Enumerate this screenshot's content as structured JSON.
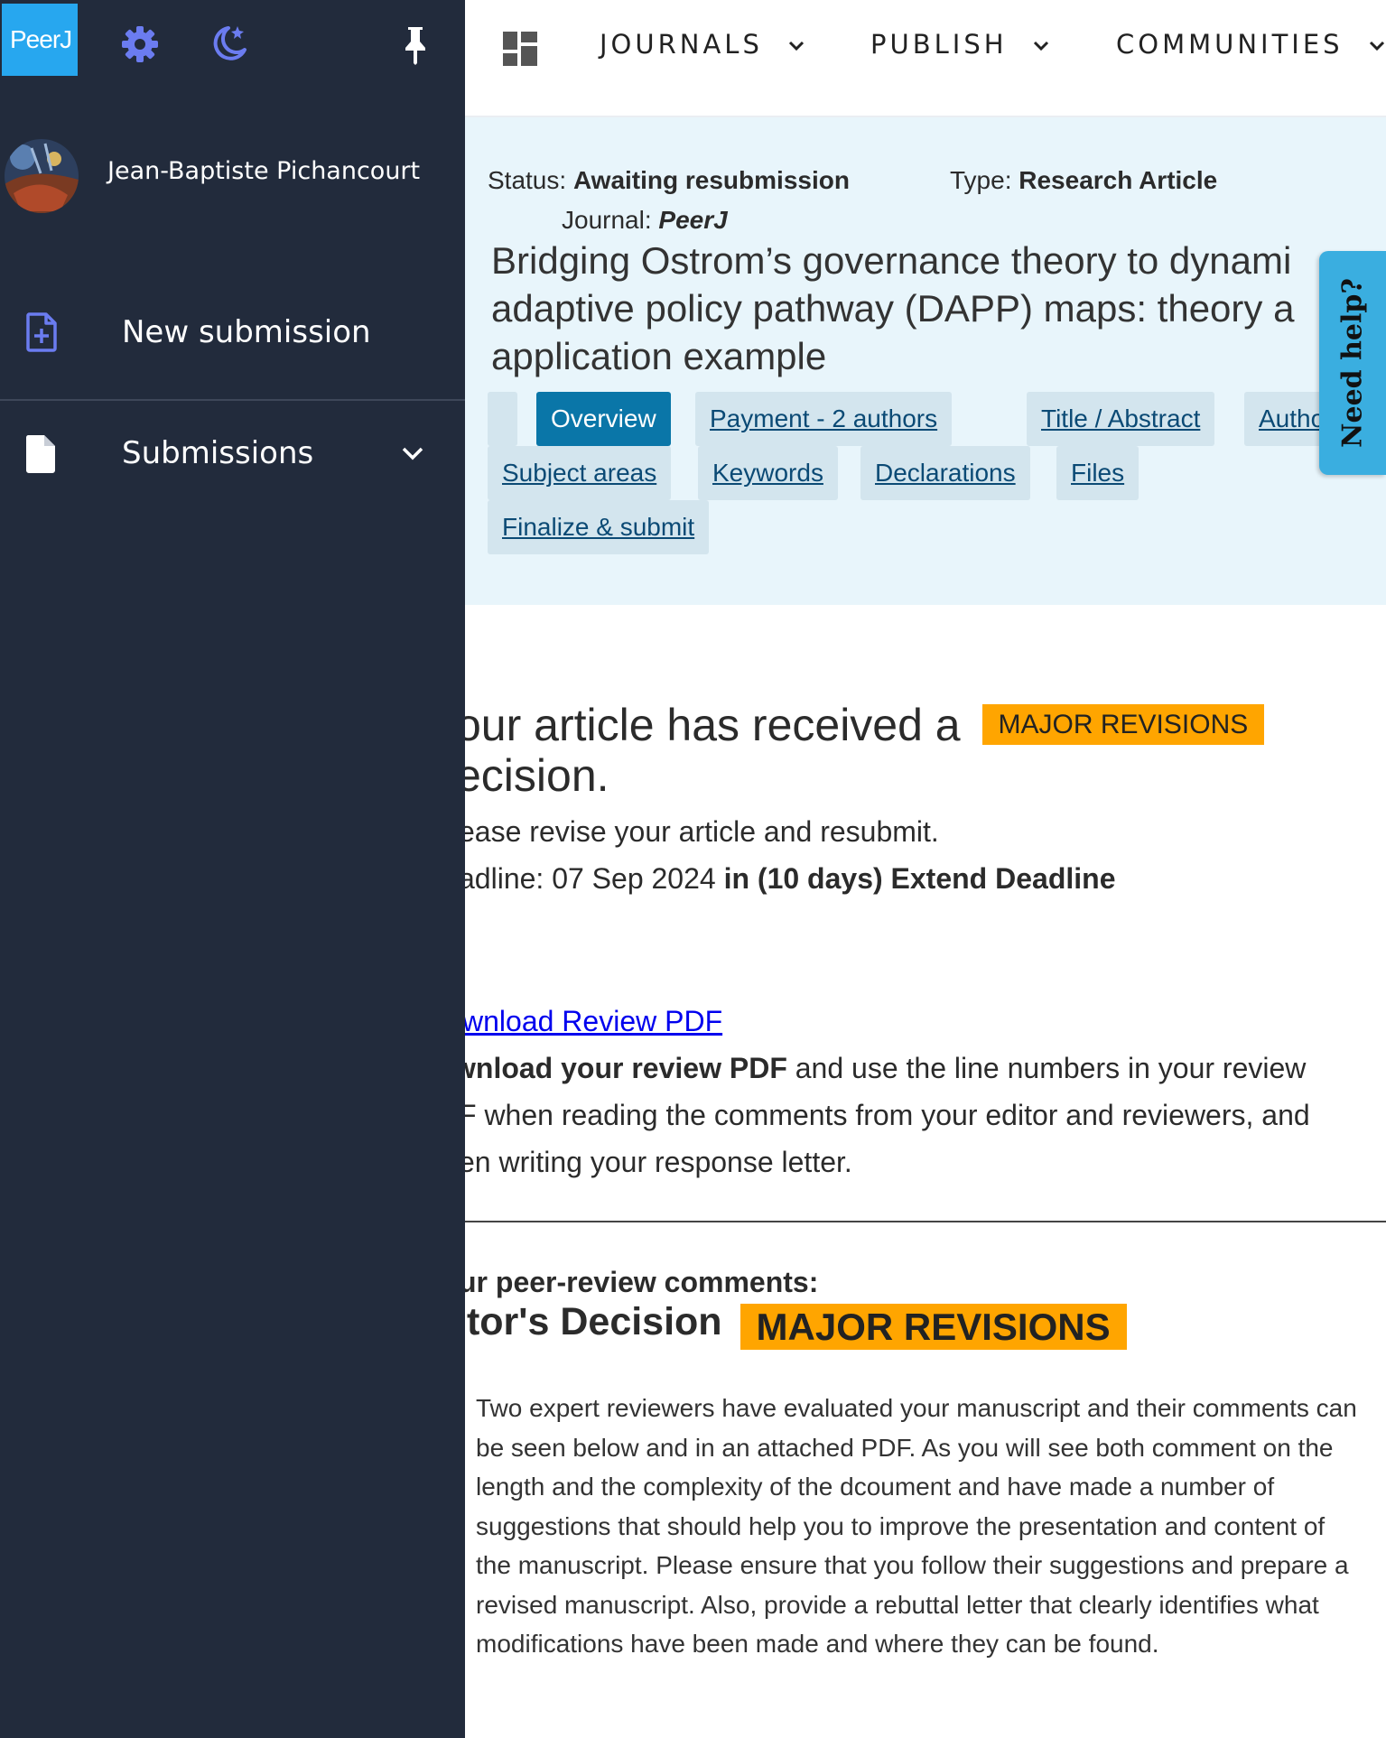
{
  "nav": {
    "items": [
      {
        "label": "JOURNALS"
      },
      {
        "label": "PUBLISH"
      },
      {
        "label": "COMMUNITIES"
      }
    ]
  },
  "sidebar": {
    "logo_text": "PeerJ",
    "user_name": "Jean-Baptiste Pichancourt",
    "new_submission_label": "New submission",
    "submissions_label": "Submissions"
  },
  "article": {
    "status_label": "Status:",
    "status_value": "Awaiting resubmission",
    "type_label": "Type:",
    "type_value": "Research Article",
    "journal_label": "Journal:",
    "journal_value": "PeerJ",
    "title": "Bridging Ostrom’s governance theory to dynami adaptive policy pathway (DAPP) maps: theory a application example"
  },
  "tabs": [
    {
      "label": "Overview"
    },
    {
      "label": "Payment - 2 authors"
    },
    {
      "label": "Title / Abstract"
    },
    {
      "label": "Autho"
    },
    {
      "label": "Subject areas"
    },
    {
      "label": "Keywords"
    },
    {
      "label": "Declarations"
    },
    {
      "label": "Files"
    },
    {
      "label": "Finalize & submit"
    }
  ],
  "help_label": "Need help?",
  "decision": {
    "heading_part1": "our article has received a",
    "badge": "MAJOR REVISIONS",
    "heading_part2": "ecision.",
    "revise_text": "ease revise your article and resubmit.",
    "deadline_prefix": "adline: 07 Sep 2024",
    "deadline_bold": "in (10 days) Extend Deadline",
    "download_link": "wnload Review PDF",
    "download_bold": "wnload your review PDF",
    "download_line1_rest": "and use the line numbers in your review",
    "download_line2": "F when reading the comments from your editor and reviewers, and",
    "download_line3": "en writing your response letter.",
    "comments_heading": "ur peer-review comments:",
    "editor_heading": "itor's Decision",
    "editor_badge": "MAJOR REVISIONS",
    "editor_text": "Two expert reviewers have evaluated your manuscript and their comments can be seen below and in an attached PDF. As you will see both comment on the length and the complexity of the dcoument and have made a number of suggestions that should help you to improve the presentation and content of the manuscript. Please ensure that you follow their suggestions and prepare a revised manuscript. Also, provide a rebuttal letter that clearly identifies what modifications have been made and where they can be found."
  },
  "colors": {
    "sidebar_bg": "#222b3c",
    "logo_bg": "#27a7ef",
    "icon_accent": "#6b7cf0",
    "header_bg": "#e8f5fb",
    "active_tab": "#0a76a8",
    "badge": "#ffa500",
    "help_tab": "#3aaee0"
  }
}
